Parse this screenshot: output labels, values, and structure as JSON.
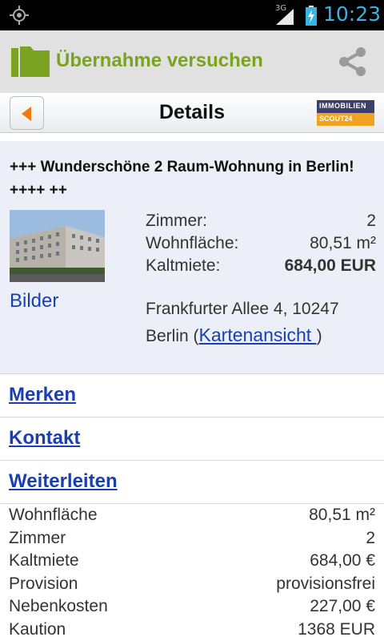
{
  "status_bar": {
    "network": "3G",
    "time": "10:23"
  },
  "action_bar": {
    "title": "Übernahme versuchen",
    "brand_color": "#7aa321"
  },
  "details_bar": {
    "heading": "Details",
    "logo_line1": "IMMOBILIEN",
    "logo_line2": "SCOUT24"
  },
  "listing": {
    "title": "+++ Wunderschöne 2 Raum-Wohnung in Berlin! ++++ ++",
    "photos_link": "Bilder",
    "facts": [
      {
        "label": "Zimmer:",
        "value": "2"
      },
      {
        "label": "Wohnfläche:",
        "value": "80,51 m²"
      },
      {
        "label": "Kaltmiete:",
        "value": "684,00 EUR"
      }
    ],
    "address_line1": "Frankfurter Allee 4, 10247",
    "address_city": "Berlin (",
    "map_link": "Kartenansicht ",
    "address_close": ")"
  },
  "actions": [
    {
      "label": "Merken"
    },
    {
      "label": "Kontakt"
    },
    {
      "label": "Weiterleiten"
    }
  ],
  "specs": [
    {
      "label": "Wohnfläche",
      "value": "80,51 m²"
    },
    {
      "label": "Zimmer",
      "value": "2"
    },
    {
      "label": "Kaltmiete",
      "value": "684,00 €"
    },
    {
      "label": "Provision",
      "value": "provisionsfrei"
    },
    {
      "label": "Nebenkosten",
      "value": "227,00 €"
    },
    {
      "label": "Kaution",
      "value": "1368 EUR"
    }
  ],
  "colors": {
    "link": "#1a3fb0",
    "status_accent": "#33b5e5",
    "listing_bg": "#eceff7"
  },
  "icons": {
    "gps": "gps-icon",
    "signal": "signal-icon",
    "battery": "battery-charging-icon",
    "app": "folder-icon",
    "share": "share-icon",
    "back": "back-arrow-icon"
  }
}
